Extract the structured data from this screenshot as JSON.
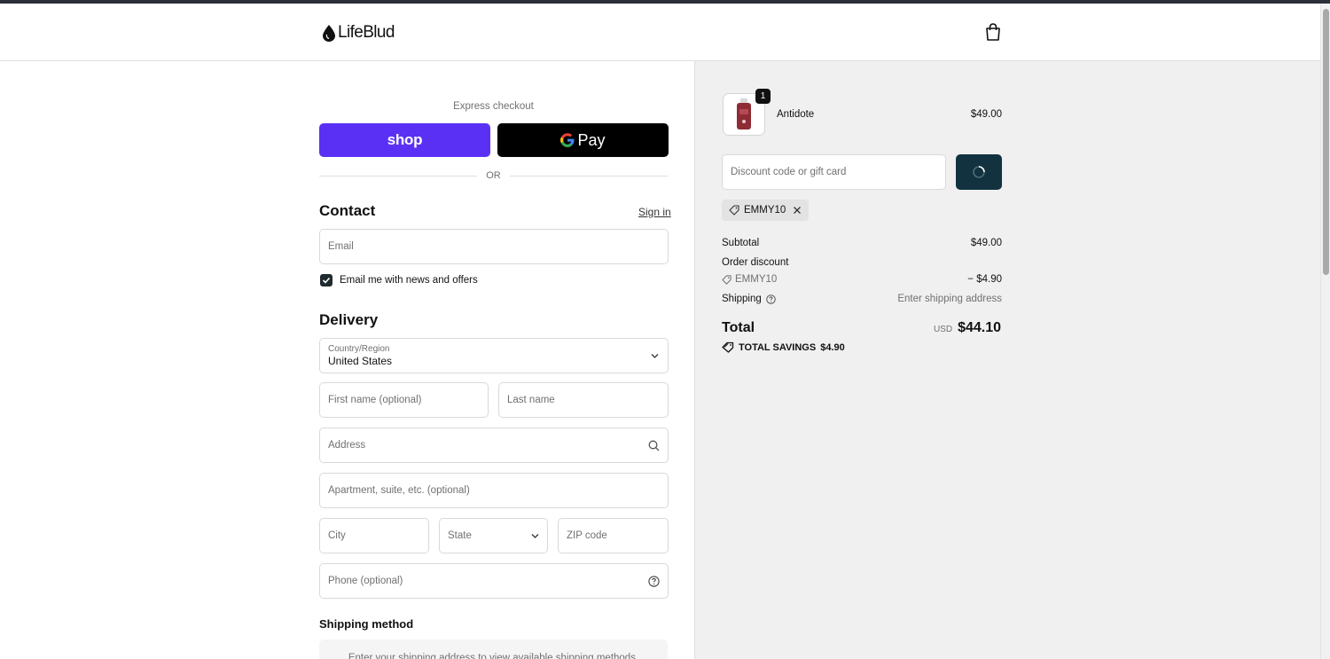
{
  "brand": {
    "name": "LifeBlud"
  },
  "icons": {
    "logo": "drop-icon",
    "cart": "shopping-bag-icon",
    "search": "search-icon",
    "help": "question-circle-icon",
    "chevron": "chevron-down-icon",
    "tag": "tag-icon",
    "close": "close-icon",
    "spinner": "spinner-icon",
    "check": "check-icon"
  },
  "colors": {
    "shop_pay": "#5a31f4",
    "gpay": "#000000",
    "apply_button": "#12323f",
    "summary_bg": "#f0f0f0"
  },
  "express": {
    "label": "Express checkout",
    "shop_label": "shop",
    "gpay_label": "Pay",
    "or_label": "OR"
  },
  "contact": {
    "title": "Contact",
    "sign_in": "Sign in",
    "email_placeholder": "Email",
    "newsletter_label": "Email me with news and offers",
    "newsletter_checked": true
  },
  "delivery": {
    "title": "Delivery",
    "country_label": "Country/Region",
    "country_value": "United States",
    "first_name_placeholder": "First name (optional)",
    "last_name_placeholder": "Last name",
    "address_placeholder": "Address",
    "apartment_placeholder": "Apartment, suite, etc. (optional)",
    "city_placeholder": "City",
    "state_placeholder": "State",
    "zip_placeholder": "ZIP code",
    "phone_placeholder": "Phone (optional)"
  },
  "shipping_method": {
    "title": "Shipping method",
    "message": "Enter your shipping address to view available shipping methods."
  },
  "summary": {
    "item": {
      "name": "Antidote",
      "price": "$49.00",
      "quantity": "1"
    },
    "discount_placeholder": "Discount code or gift card",
    "applied_code": "EMMY10",
    "subtotal_label": "Subtotal",
    "subtotal_value": "$49.00",
    "order_discount_label": "Order discount",
    "discount_code": "EMMY10",
    "discount_value": "− $4.90",
    "shipping_label": "Shipping",
    "shipping_value": "Enter shipping address",
    "total_label": "Total",
    "currency": "USD",
    "total_value": "$44.10",
    "savings_label": "TOTAL SAVINGS",
    "savings_value": "$4.90"
  }
}
